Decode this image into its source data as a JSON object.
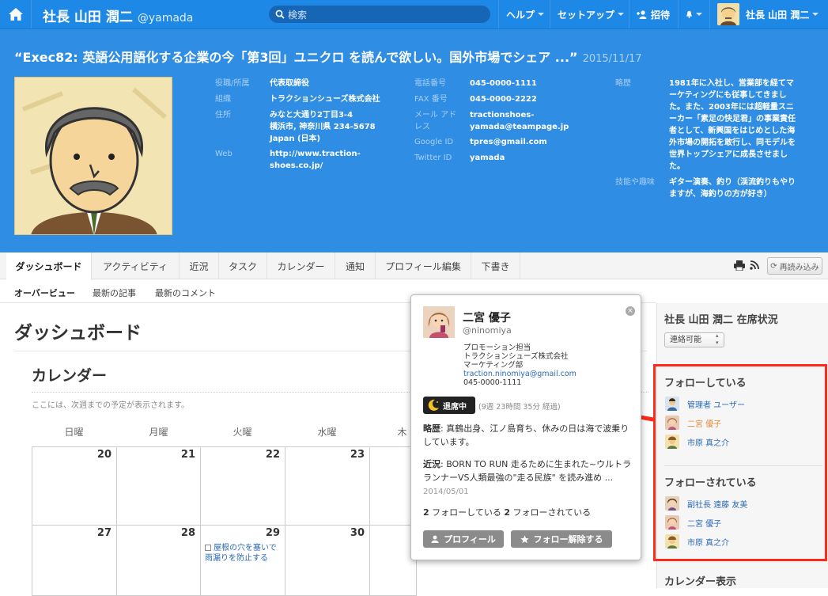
{
  "topbar": {
    "user_name": "社長 山田 潤二",
    "user_handle": "@yamada",
    "search_placeholder": "検索",
    "help": "ヘルプ",
    "setup": "セットアップ",
    "invite": "招待",
    "account_name": "社長 山田 潤二"
  },
  "header": {
    "post_title": "“Exec82: 英語公用語化する企業の今「第3回」ユニクロ を読んで欲しい。国外市場でシェア ...”",
    "post_date": "2015/11/17",
    "fields": {
      "position_k": "役職/所属",
      "position_v": "代表取締役",
      "org_k": "組織",
      "org_v": "トラクションシューズ株式会社",
      "address_k": "住所",
      "address_v1": "みなと大通り2丁目3-4",
      "address_v2": "横浜市, 神奈川県 234-5678",
      "address_v3": "Japan (日本)",
      "web_k": "Web",
      "web_v1": "http://www.traction-",
      "web_v2": "shoes.co.jp/",
      "phone_k": "電話番号",
      "phone_v": "045-0000-1111",
      "fax_k": "FAX 番号",
      "fax_v": "045-0000-2222",
      "mail_k1": "メール アド",
      "mail_k2": "レス",
      "mail_v1": "tractionshoes-",
      "mail_v2": "yamada@teampage.jp",
      "google_k": "Google ID",
      "google_v": "tpres@gmail.com",
      "twitter_k": "Twitter ID",
      "twitter_v": "yamada",
      "bio_k": "略歴",
      "bio_v1": "1981年に入社し、営業部を経てマ",
      "bio_v2": "ーケティングにも従事してきまし",
      "bio_v3": "た。また、2003年には超軽量スニ",
      "bio_v4": "ーカー「素足の快足君」の事業責任",
      "bio_v5": "者として、新興国をはじめとした海",
      "bio_v6": "外市場の開拓を敢行し、同モデルを",
      "bio_v7": "世界トップシェアに成長させまし",
      "bio_v8": "た。",
      "skill_k": "技能や趣味",
      "skill_v1": "ギター演奏、釣り（渓流釣りもやり",
      "skill_v2": "ますが、海釣りの方が好き）"
    }
  },
  "tabs": [
    "ダッシュボード",
    "アクティビティ",
    "近況",
    "タスク",
    "カレンダー",
    "通知",
    "プロフィール編集",
    "下書き"
  ],
  "reload": "再読み込み",
  "subtabs": [
    "オーバービュー",
    "最新の記事",
    "最新のコメント"
  ],
  "main": {
    "title": "ダッシュボード",
    "calendar_title": "カレンダー",
    "calendar_note": "ここには、次週までの予定が表示されます。",
    "days": [
      "日曜",
      "月曜",
      "火曜",
      "水曜",
      "木"
    ],
    "row1": [
      "20",
      "21",
      "22",
      "23"
    ],
    "row2": [
      "27",
      "28",
      "29",
      "30"
    ],
    "event": "屋根の穴を塞いで雨漏りを防止する"
  },
  "popup": {
    "name": "二宮 優子",
    "handle": "@ninomiya",
    "info1": "プロモーション担当",
    "info2": "トラクションシューズ株式会社",
    "info3": "マーケティング部",
    "email": "traction.ninomiya@gmail.com",
    "phone": "045-0000-1111",
    "status": "退席中",
    "elapsed": "(9週 23時間 35分 経過)",
    "bio_label": "略歴",
    "bio_text": ": 真鶴出身、江ノ島育ち、休みの日は海で波乗りしています。",
    "recent_label": "近況",
    "recent_text": ": BORN TO RUN 走るために生まれた~ウルトラランナーVS人類最強の\"走る民族\" を読み進め ...",
    "recent_date": "2014/05/01",
    "following_count": "2",
    "following_label": "フォローしている",
    "followers_count": "2",
    "followers_label": "フォローされている",
    "profile_btn": "プロフィール",
    "unfollow_btn": "フォロー解除する"
  },
  "sidebar": {
    "presence_title": "社長 山田 潤二 在席状況",
    "presence_value": "連絡可能",
    "following_title": "フォローしている",
    "following": [
      "管理者 ユーザー",
      "二宮 優子",
      "市原 真之介"
    ],
    "followers_title": "フォローされている",
    "followers": [
      "副社長 遠藤 友美",
      "二宮 優子",
      "市原 真之介"
    ],
    "calendar_title": "カレンダー表示"
  },
  "colors": {
    "brand": "#1d88e5",
    "header": "#2f8de4",
    "highlight": "#ff2a1a",
    "link": "#2a6ab8"
  }
}
